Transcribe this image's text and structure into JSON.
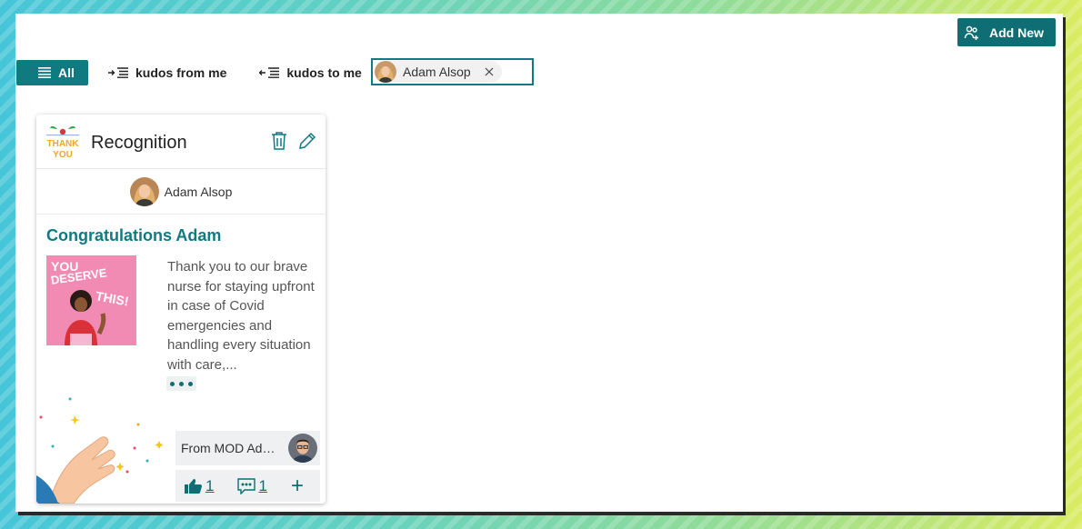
{
  "toolbar": {
    "add_new_label": "Add New"
  },
  "filters": {
    "tabs": [
      {
        "label": "All",
        "icon": "list-icon",
        "active": true
      },
      {
        "label": "kudos from me",
        "icon": "indent-list-icon",
        "active": false
      },
      {
        "label": "kudos to me",
        "icon": "outdent-list-icon",
        "active": false
      }
    ],
    "person_filter": {
      "name": "Adam Alsop"
    }
  },
  "card": {
    "badge_line1": "THANK",
    "badge_line2": "YOU",
    "category": "Recognition",
    "recipient": "Adam Alsop",
    "title": "Congratulations Adam",
    "image_line1": "YOU",
    "image_line2": "DESERVE",
    "image_line3": "THIS!",
    "message": "Thank you to our brave nurse for staying upfront in case of Covid emergencies and handling every situation with care,...",
    "from": "From MOD Administrator",
    "likes": "1",
    "comments": "1",
    "add_symbol": "+"
  },
  "colors": {
    "accent": "#0f7a80",
    "accent_dark": "#0f6e73"
  }
}
